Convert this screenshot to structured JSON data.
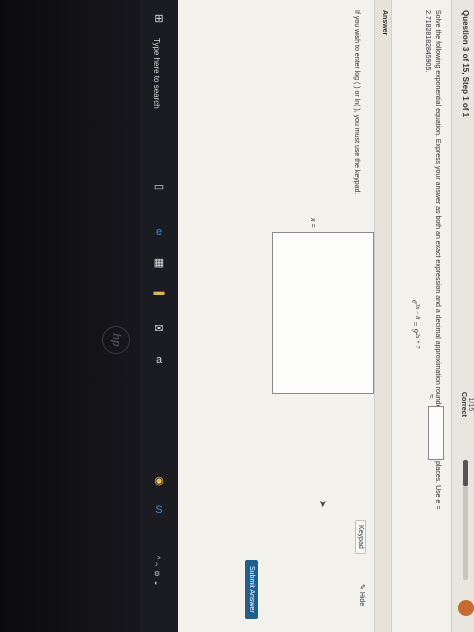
{
  "header": {
    "question_label": "Question 3 of 15, Step 1 of 1",
    "score_fraction": "1/15",
    "score_status": "Correct",
    "progress_fraction": 0.22
  },
  "question": {
    "prompt": "Solve the following exponential equation. Express your answer as both an exact expression and a decimal approximation rounded to two decimal places. Use e = 2.71828182845905.",
    "equation_base_left": "e",
    "equation_exp_left": "3x − 8",
    "equation_eq": " = 9",
    "equation_exp_right": "2x + 7"
  },
  "answer": {
    "label": "Answer",
    "hint": "If you wish to enter log ( ) or ln( ), you must use the keypad.",
    "x_label": "x =",
    "approx_symbol": "≈",
    "keypad_label": "Keypad",
    "hide_label": "Hide",
    "submit_label": "Submit Answer"
  },
  "taskbar": {
    "search_placeholder": "Type here to search",
    "icons": [
      "windows-icon",
      "search-icon",
      "task-view-icon",
      "edge-icon",
      "store-icon",
      "folder-icon",
      "mail-icon",
      "amazon-icon",
      "chrome-icon",
      "skype-icon"
    ]
  },
  "colors": {
    "submit": "#1f5f8f",
    "taskbar": "#1b1b22"
  }
}
